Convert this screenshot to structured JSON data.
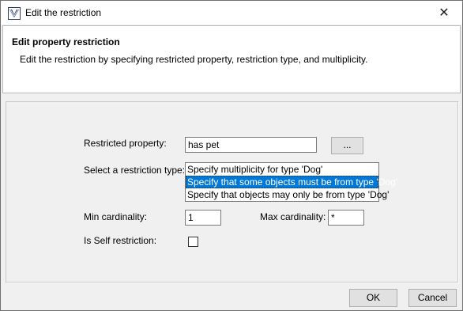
{
  "window": {
    "title": "Edit the restriction",
    "close_glyph": "✕"
  },
  "header": {
    "title": "Edit property restriction",
    "description": "Edit the restriction by specifying restricted property, restriction type, and multiplicity."
  },
  "form": {
    "restricted_property_label": "Restricted property:",
    "restricted_property_value": "has pet",
    "browse_button_label": "...",
    "restriction_type_label": "Select a restriction type:",
    "restriction_types": [
      {
        "label": "Specify multiplicity for type 'Dog'",
        "selected": false
      },
      {
        "label": "Specify that some objects must be from type 'Dog'",
        "selected": true
      },
      {
        "label": "Specify that objects may only be from type 'Dog'",
        "selected": false
      }
    ],
    "min_cardinality_label": "Min cardinality:",
    "min_cardinality_value": "1",
    "max_cardinality_label": "Max cardinality:",
    "max_cardinality_value": "*",
    "self_restriction_label": "Is Self restriction:",
    "self_restriction_checked": false
  },
  "footer": {
    "ok_label": "OK",
    "cancel_label": "Cancel"
  },
  "colors": {
    "selection": "#0078d7",
    "window_bg": "#f0f0f0",
    "header_bg": "#ffffff"
  }
}
